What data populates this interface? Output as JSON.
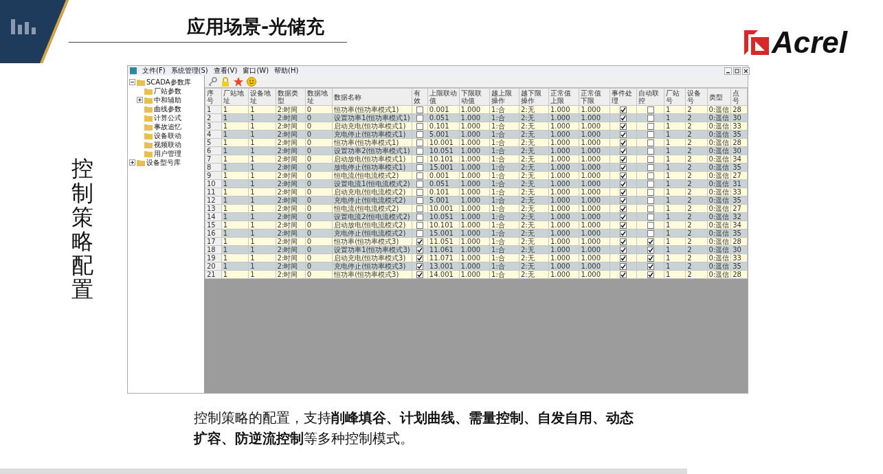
{
  "slide": {
    "title": "应用场景-光储充",
    "logo": "Acrel",
    "side_label": "控制策略配置",
    "caption": "控制策略的配置，支持**削峰填谷、计划曲线、需量控制、自发自用、动态扩容、防逆流控制**等多种控制模式。"
  },
  "app": {
    "menu": [
      "文件(F)",
      "系统管理(S)",
      "查看(V)",
      "窗口(W)",
      "帮助(H)"
    ],
    "tree": [
      {
        "label": "SCADA参数库",
        "kind": "group",
        "expanded": true,
        "children": [
          {
            "label": "厂站参数",
            "kind": "leaf"
          },
          {
            "label": "中和辅助",
            "kind": "group",
            "expanded": false
          },
          {
            "label": "曲线参数",
            "kind": "leaf"
          },
          {
            "label": "计算公式",
            "kind": "leaf"
          },
          {
            "label": "事故追忆",
            "kind": "leaf"
          },
          {
            "label": "设备联动",
            "kind": "leaf"
          },
          {
            "label": "视频联动",
            "kind": "leaf"
          },
          {
            "label": "用户管理",
            "kind": "leaf"
          }
        ]
      },
      {
        "label": "设备型号库",
        "kind": "group",
        "expanded": false
      }
    ],
    "table": {
      "columns": [
        {
          "label": "序号",
          "kind": "text"
        },
        {
          "label": "厂站地址",
          "kind": "text"
        },
        {
          "label": "设备地址",
          "kind": "text"
        },
        {
          "label": "数据类型",
          "kind": "text"
        },
        {
          "label": "数据地址",
          "kind": "text"
        },
        {
          "label": "数据名称",
          "kind": "text"
        },
        {
          "label": "有效",
          "kind": "check"
        },
        {
          "label": "上限联动值",
          "kind": "text"
        },
        {
          "label": "下限联动值",
          "kind": "text"
        },
        {
          "label": "越上限操作",
          "kind": "text"
        },
        {
          "label": "越下限操作",
          "kind": "text"
        },
        {
          "label": "正常值上限",
          "kind": "text"
        },
        {
          "label": "正常值下限",
          "kind": "text"
        },
        {
          "label": "事件处理",
          "kind": "check"
        },
        {
          "label": "自动联控",
          "kind": "check"
        },
        {
          "label": "厂站号",
          "kind": "text"
        },
        {
          "label": "设备号",
          "kind": "text"
        },
        {
          "label": "类型",
          "kind": "text"
        },
        {
          "label": "点号",
          "kind": "text"
        }
      ],
      "rows": [
        {
          "cells": [
            "1",
            "1",
            "1",
            "2:时间",
            "0",
            "恒功率(恒功率模式1)",
            {
              "checked": false
            },
            "0.001",
            "1.000",
            "1:合",
            "2:无",
            "1.000",
            "1.000",
            {
              "checked": true
            },
            {
              "checked": false
            },
            "1",
            "2",
            "0:遥信",
            "28"
          ]
        },
        {
          "cells": [
            "2",
            "1",
            "1",
            "2:时间",
            "0",
            "设置功率1(恒功率模式1)",
            {
              "checked": false
            },
            "0.051",
            "1.000",
            "1:合",
            "2:无",
            "1.000",
            "1.000",
            {
              "checked": true
            },
            {
              "checked": false
            },
            "1",
            "2",
            "0:遥信",
            "30"
          ]
        },
        {
          "cells": [
            "3",
            "1",
            "1",
            "2:时间",
            "0",
            "启动充电(恒功率模式1)",
            {
              "checked": false
            },
            "0.101",
            "1.000",
            "1:合",
            "2:无",
            "1.000",
            "1.000",
            {
              "checked": true
            },
            {
              "checked": false
            },
            "1",
            "2",
            "0:遥信",
            "33"
          ]
        },
        {
          "cells": [
            "4",
            "1",
            "1",
            "2:时间",
            "0",
            "充电停止(恒功率模式1)",
            {
              "checked": false
            },
            "5.001",
            "1.000",
            "1:合",
            "2:无",
            "1.000",
            "1.000",
            {
              "checked": true
            },
            {
              "checked": false
            },
            "1",
            "2",
            "0:遥信",
            "35"
          ]
        },
        {
          "cells": [
            "5",
            "1",
            "1",
            "2:时间",
            "0",
            "恒功率(恒功率模式1)",
            {
              "checked": false
            },
            "10.001",
            "1.000",
            "1:合",
            "2:无",
            "1.000",
            "1.000",
            {
              "checked": true
            },
            {
              "checked": false
            },
            "1",
            "2",
            "0:遥信",
            "28"
          ]
        },
        {
          "cells": [
            "6",
            "1",
            "1",
            "2:时间",
            "0",
            "设置功率2(恒功率模式1)",
            {
              "checked": false
            },
            "10.051",
            "1.000",
            "1:合",
            "2:无",
            "1.000",
            "1.000",
            {
              "checked": true
            },
            {
              "checked": false
            },
            "1",
            "2",
            "0:遥信",
            "30"
          ]
        },
        {
          "cells": [
            "7",
            "1",
            "1",
            "2:时间",
            "0",
            "启动放电(恒功率模式1)",
            {
              "checked": false
            },
            "10.101",
            "1.000",
            "1:合",
            "2:无",
            "1.000",
            "1.000",
            {
              "checked": true
            },
            {
              "checked": false
            },
            "1",
            "2",
            "0:遥信",
            "34"
          ]
        },
        {
          "cells": [
            "8",
            "1",
            "1",
            "2:时间",
            "0",
            "放电停止(恒功率模式1)",
            {
              "checked": false
            },
            "15.001",
            "1.000",
            "1:合",
            "2:无",
            "1.000",
            "1.000",
            {
              "checked": true
            },
            {
              "checked": false
            },
            "1",
            "2",
            "0:遥信",
            "35"
          ]
        },
        {
          "cells": [
            "9",
            "1",
            "1",
            "2:时间",
            "0",
            "恒电流(恒电流模式2)",
            {
              "checked": false
            },
            "0.001",
            "1.000",
            "1:合",
            "2:无",
            "1.000",
            "1.000",
            {
              "checked": true
            },
            {
              "checked": false
            },
            "1",
            "2",
            "0:遥信",
            "27"
          ]
        },
        {
          "cells": [
            "10",
            "1",
            "1",
            "2:时间",
            "0",
            "设置电流1(恒电流模式2)",
            {
              "checked": false
            },
            "0.051",
            "1.000",
            "1:合",
            "2:无",
            "1.000",
            "1.000",
            {
              "checked": true
            },
            {
              "checked": false
            },
            "1",
            "2",
            "0:遥信",
            "31"
          ]
        },
        {
          "cells": [
            "11",
            "1",
            "1",
            "2:时间",
            "0",
            "启动充电(恒电流模式2)",
            {
              "checked": false
            },
            "0.101",
            "1.000",
            "1:合",
            "2:无",
            "1.000",
            "1.000",
            {
              "checked": true
            },
            {
              "checked": false
            },
            "1",
            "2",
            "0:遥信",
            "33"
          ]
        },
        {
          "cells": [
            "12",
            "1",
            "1",
            "2:时间",
            "0",
            "充电停止(恒电流模式2)",
            {
              "checked": false
            },
            "5.001",
            "1.000",
            "1:合",
            "2:无",
            "1.000",
            "1.000",
            {
              "checked": true
            },
            {
              "checked": false
            },
            "1",
            "2",
            "0:遥信",
            "35"
          ]
        },
        {
          "cells": [
            "13",
            "1",
            "1",
            "2:时间",
            "0",
            "恒电流(恒电流模式2)",
            {
              "checked": false
            },
            "10.001",
            "1.000",
            "1:合",
            "2:无",
            "1.000",
            "1.000",
            {
              "checked": true
            },
            {
              "checked": false
            },
            "1",
            "2",
            "0:遥信",
            "27"
          ]
        },
        {
          "cells": [
            "14",
            "1",
            "1",
            "2:时间",
            "0",
            "设置电流2(恒电流模式2)",
            {
              "checked": false
            },
            "10.051",
            "1.000",
            "1:合",
            "2:无",
            "1.000",
            "1.000",
            {
              "checked": true
            },
            {
              "checked": false
            },
            "1",
            "2",
            "0:遥信",
            "32"
          ]
        },
        {
          "cells": [
            "15",
            "1",
            "1",
            "2:时间",
            "0",
            "启动放电(恒电流模式2)",
            {
              "checked": false
            },
            "10.101",
            "1.000",
            "1:合",
            "2:无",
            "1.000",
            "1.000",
            {
              "checked": true
            },
            {
              "checked": false
            },
            "1",
            "2",
            "0:遥信",
            "34"
          ]
        },
        {
          "cells": [
            "16",
            "1",
            "1",
            "2:时间",
            "0",
            "充电停止(恒电流模式2)",
            {
              "checked": false
            },
            "15.001",
            "1.000",
            "1:合",
            "2:无",
            "1.000",
            "1.000",
            {
              "checked": true
            },
            {
              "checked": false
            },
            "1",
            "2",
            "0:遥信",
            "35"
          ]
        },
        {
          "cells": [
            "17",
            "1",
            "1",
            "2:时间",
            "0",
            "恒功率(恒功率模式3)",
            {
              "checked": true
            },
            "11.051",
            "1.000",
            "1:合",
            "2:无",
            "1.000",
            "1.000",
            {
              "checked": true
            },
            {
              "checked": true
            },
            "1",
            "2",
            "0:遥信",
            "28"
          ]
        },
        {
          "cells": [
            "18",
            "1",
            "1",
            "2:时间",
            "0",
            "设置功率1(恒功率模式3)",
            {
              "checked": true
            },
            "11.061",
            "1.000",
            "1:合",
            "2:无",
            "1.000",
            "1.000",
            {
              "checked": true
            },
            {
              "checked": true
            },
            "1",
            "2",
            "0:遥信",
            "30"
          ]
        },
        {
          "cells": [
            "19",
            "1",
            "1",
            "2:时间",
            "0",
            "启动充电(恒功率模式3)",
            {
              "checked": true
            },
            "11.071",
            "1.000",
            "1:合",
            "2:无",
            "1.000",
            "1.000",
            {
              "checked": true
            },
            {
              "checked": true
            },
            "1",
            "2",
            "0:遥信",
            "33"
          ]
        },
        {
          "cells": [
            "20",
            "1",
            "1",
            "2:时间",
            "0",
            "充电停止(恒功率模式3)",
            {
              "checked": true
            },
            "13.001",
            "1.000",
            "1:合",
            "2:无",
            "1.000",
            "1.000",
            {
              "checked": true
            },
            {
              "checked": true
            },
            "1",
            "2",
            "0:遥信",
            "35"
          ]
        },
        {
          "cells": [
            "21",
            "1",
            "1",
            "2:时间",
            "0",
            "恒功率(恒功率模式3)",
            {
              "checked": true
            },
            "14.001",
            "1.000",
            "1:合",
            "2:无",
            "1.000",
            "1.000",
            {
              "checked": true
            },
            {
              "checked": true
            },
            "1",
            "2",
            "0:遥信",
            "28"
          ]
        }
      ]
    }
  }
}
